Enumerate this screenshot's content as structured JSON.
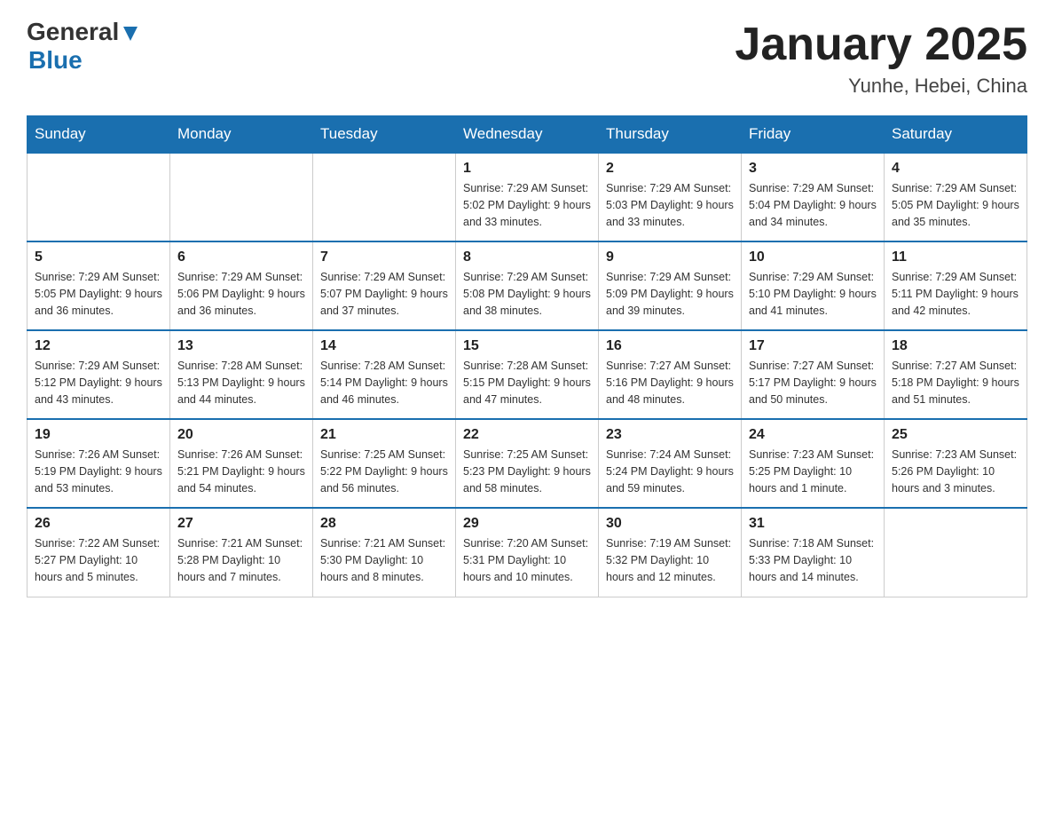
{
  "logo": {
    "general": "General",
    "blue": "Blue"
  },
  "title": "January 2025",
  "subtitle": "Yunhe, Hebei, China",
  "days_of_week": [
    "Sunday",
    "Monday",
    "Tuesday",
    "Wednesday",
    "Thursday",
    "Friday",
    "Saturday"
  ],
  "weeks": [
    [
      {
        "day": "",
        "info": ""
      },
      {
        "day": "",
        "info": ""
      },
      {
        "day": "",
        "info": ""
      },
      {
        "day": "1",
        "info": "Sunrise: 7:29 AM\nSunset: 5:02 PM\nDaylight: 9 hours\nand 33 minutes."
      },
      {
        "day": "2",
        "info": "Sunrise: 7:29 AM\nSunset: 5:03 PM\nDaylight: 9 hours\nand 33 minutes."
      },
      {
        "day": "3",
        "info": "Sunrise: 7:29 AM\nSunset: 5:04 PM\nDaylight: 9 hours\nand 34 minutes."
      },
      {
        "day": "4",
        "info": "Sunrise: 7:29 AM\nSunset: 5:05 PM\nDaylight: 9 hours\nand 35 minutes."
      }
    ],
    [
      {
        "day": "5",
        "info": "Sunrise: 7:29 AM\nSunset: 5:05 PM\nDaylight: 9 hours\nand 36 minutes."
      },
      {
        "day": "6",
        "info": "Sunrise: 7:29 AM\nSunset: 5:06 PM\nDaylight: 9 hours\nand 36 minutes."
      },
      {
        "day": "7",
        "info": "Sunrise: 7:29 AM\nSunset: 5:07 PM\nDaylight: 9 hours\nand 37 minutes."
      },
      {
        "day": "8",
        "info": "Sunrise: 7:29 AM\nSunset: 5:08 PM\nDaylight: 9 hours\nand 38 minutes."
      },
      {
        "day": "9",
        "info": "Sunrise: 7:29 AM\nSunset: 5:09 PM\nDaylight: 9 hours\nand 39 minutes."
      },
      {
        "day": "10",
        "info": "Sunrise: 7:29 AM\nSunset: 5:10 PM\nDaylight: 9 hours\nand 41 minutes."
      },
      {
        "day": "11",
        "info": "Sunrise: 7:29 AM\nSunset: 5:11 PM\nDaylight: 9 hours\nand 42 minutes."
      }
    ],
    [
      {
        "day": "12",
        "info": "Sunrise: 7:29 AM\nSunset: 5:12 PM\nDaylight: 9 hours\nand 43 minutes."
      },
      {
        "day": "13",
        "info": "Sunrise: 7:28 AM\nSunset: 5:13 PM\nDaylight: 9 hours\nand 44 minutes."
      },
      {
        "day": "14",
        "info": "Sunrise: 7:28 AM\nSunset: 5:14 PM\nDaylight: 9 hours\nand 46 minutes."
      },
      {
        "day": "15",
        "info": "Sunrise: 7:28 AM\nSunset: 5:15 PM\nDaylight: 9 hours\nand 47 minutes."
      },
      {
        "day": "16",
        "info": "Sunrise: 7:27 AM\nSunset: 5:16 PM\nDaylight: 9 hours\nand 48 minutes."
      },
      {
        "day": "17",
        "info": "Sunrise: 7:27 AM\nSunset: 5:17 PM\nDaylight: 9 hours\nand 50 minutes."
      },
      {
        "day": "18",
        "info": "Sunrise: 7:27 AM\nSunset: 5:18 PM\nDaylight: 9 hours\nand 51 minutes."
      }
    ],
    [
      {
        "day": "19",
        "info": "Sunrise: 7:26 AM\nSunset: 5:19 PM\nDaylight: 9 hours\nand 53 minutes."
      },
      {
        "day": "20",
        "info": "Sunrise: 7:26 AM\nSunset: 5:21 PM\nDaylight: 9 hours\nand 54 minutes."
      },
      {
        "day": "21",
        "info": "Sunrise: 7:25 AM\nSunset: 5:22 PM\nDaylight: 9 hours\nand 56 minutes."
      },
      {
        "day": "22",
        "info": "Sunrise: 7:25 AM\nSunset: 5:23 PM\nDaylight: 9 hours\nand 58 minutes."
      },
      {
        "day": "23",
        "info": "Sunrise: 7:24 AM\nSunset: 5:24 PM\nDaylight: 9 hours\nand 59 minutes."
      },
      {
        "day": "24",
        "info": "Sunrise: 7:23 AM\nSunset: 5:25 PM\nDaylight: 10 hours\nand 1 minute."
      },
      {
        "day": "25",
        "info": "Sunrise: 7:23 AM\nSunset: 5:26 PM\nDaylight: 10 hours\nand 3 minutes."
      }
    ],
    [
      {
        "day": "26",
        "info": "Sunrise: 7:22 AM\nSunset: 5:27 PM\nDaylight: 10 hours\nand 5 minutes."
      },
      {
        "day": "27",
        "info": "Sunrise: 7:21 AM\nSunset: 5:28 PM\nDaylight: 10 hours\nand 7 minutes."
      },
      {
        "day": "28",
        "info": "Sunrise: 7:21 AM\nSunset: 5:30 PM\nDaylight: 10 hours\nand 8 minutes."
      },
      {
        "day": "29",
        "info": "Sunrise: 7:20 AM\nSunset: 5:31 PM\nDaylight: 10 hours\nand 10 minutes."
      },
      {
        "day": "30",
        "info": "Sunrise: 7:19 AM\nSunset: 5:32 PM\nDaylight: 10 hours\nand 12 minutes."
      },
      {
        "day": "31",
        "info": "Sunrise: 7:18 AM\nSunset: 5:33 PM\nDaylight: 10 hours\nand 14 minutes."
      },
      {
        "day": "",
        "info": ""
      }
    ]
  ]
}
